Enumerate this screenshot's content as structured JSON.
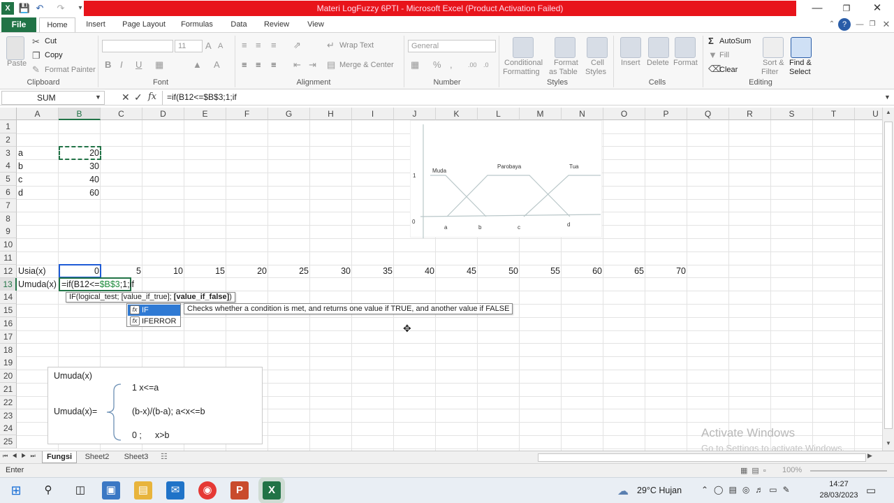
{
  "window": {
    "title": "Materi LogFuzzy 6PTI - Microsoft Excel (Product Activation Failed)"
  },
  "ribbon": {
    "tabs": [
      "File",
      "Home",
      "Insert",
      "Page Layout",
      "Formulas",
      "Data",
      "Review",
      "View"
    ],
    "clipboard": {
      "paste": "Paste",
      "cut": "Cut",
      "copy": "Copy",
      "format_painter": "Format Painter",
      "label": "Clipboard"
    },
    "font": {
      "size": "11",
      "label": "Font"
    },
    "alignment": {
      "wrap_text": "Wrap Text",
      "merge_center": "Merge & Center",
      "label": "Alignment"
    },
    "number": {
      "format": "General",
      "label": "Number"
    },
    "styles": {
      "conditional_1": "Conditional",
      "conditional_2": "Formatting",
      "format_table_1": "Format",
      "format_table_2": "as Table",
      "cell_styles_1": "Cell",
      "cell_styles_2": "Styles",
      "label": "Styles"
    },
    "cells": {
      "insert": "Insert",
      "delete": "Delete",
      "format": "Format",
      "label": "Cells"
    },
    "editing": {
      "autosum": "AutoSum",
      "fill": "Fill",
      "clear": "Clear",
      "sort_1": "Sort &",
      "sort_2": "Filter",
      "find_1": "Find &",
      "find_2": "Select",
      "label": "Editing"
    }
  },
  "formula_bar": {
    "name_box": "SUM",
    "fx": "fx",
    "formula": "=if(B12<=$B$3;1;if"
  },
  "columns": [
    "A",
    "B",
    "C",
    "D",
    "E",
    "F",
    "G",
    "H",
    "I",
    "J",
    "K",
    "L",
    "M",
    "N",
    "O",
    "P",
    "Q",
    "R",
    "S",
    "T",
    "U"
  ],
  "rows": [
    "1",
    "2",
    "3",
    "4",
    "5",
    "6",
    "7",
    "8",
    "9",
    "10",
    "11",
    "12",
    "13",
    "14",
    "15",
    "16",
    "17",
    "18",
    "19",
    "20",
    "21",
    "22",
    "23",
    "24",
    "25"
  ],
  "cells": {
    "a3": "a",
    "b3": "20",
    "a4": "b",
    "b4": "30",
    "a5": "c",
    "b5": "40",
    "a6": "d",
    "b6": "60",
    "a12": "Usia(x)",
    "row12_values": [
      "0",
      "5",
      "10",
      "15",
      "20",
      "25",
      "30",
      "35",
      "40",
      "45",
      "50",
      "55",
      "60",
      "65",
      "70"
    ],
    "a13": "Umuda(x)",
    "b13_edit": {
      "prefix": "=if(B12<=",
      "ref": "$B$3",
      "suffix": ";1;if"
    }
  },
  "chart_image": {
    "labels": {
      "muda": "Muda",
      "parobaya": "Parobaya",
      "tua": "Tua",
      "one": "1",
      "zero": "0",
      "a": "a",
      "b": "b",
      "c": "c",
      "d": "d"
    }
  },
  "autocomplete": {
    "syntax_pre": "IF(logical_test; [value_if_true]; ",
    "syntax_bold": "[value_if_false]",
    "syntax_post": ")",
    "items": [
      "IF",
      "IFERROR"
    ],
    "description": "Checks whether a condition is met, and returns one value if TRUE, and another value if FALSE"
  },
  "formula_box": {
    "title": "Umuda(x)",
    "lhs": "Umuda(x)=",
    "case1": "1  x<=a",
    "case2": "(b-x)/(b-a); a<x<=b",
    "case3_val": "0 ;",
    "case3_cond": "x>b"
  },
  "sheets": [
    "Fungsi",
    "Sheet2",
    "Sheet3"
  ],
  "status": {
    "mode": "Enter",
    "zoom": "100%"
  },
  "watermark": {
    "line1": "Activate Windows",
    "line2": "Go to Settings to activate Windows."
  },
  "taskbar": {
    "weather": "29°C  Hujan",
    "time": "14:27",
    "date": "28/03/2023"
  },
  "colors": {
    "excel_green": "#217346",
    "title_red": "#e8141b",
    "selection_blue": "#1e5bd6"
  }
}
